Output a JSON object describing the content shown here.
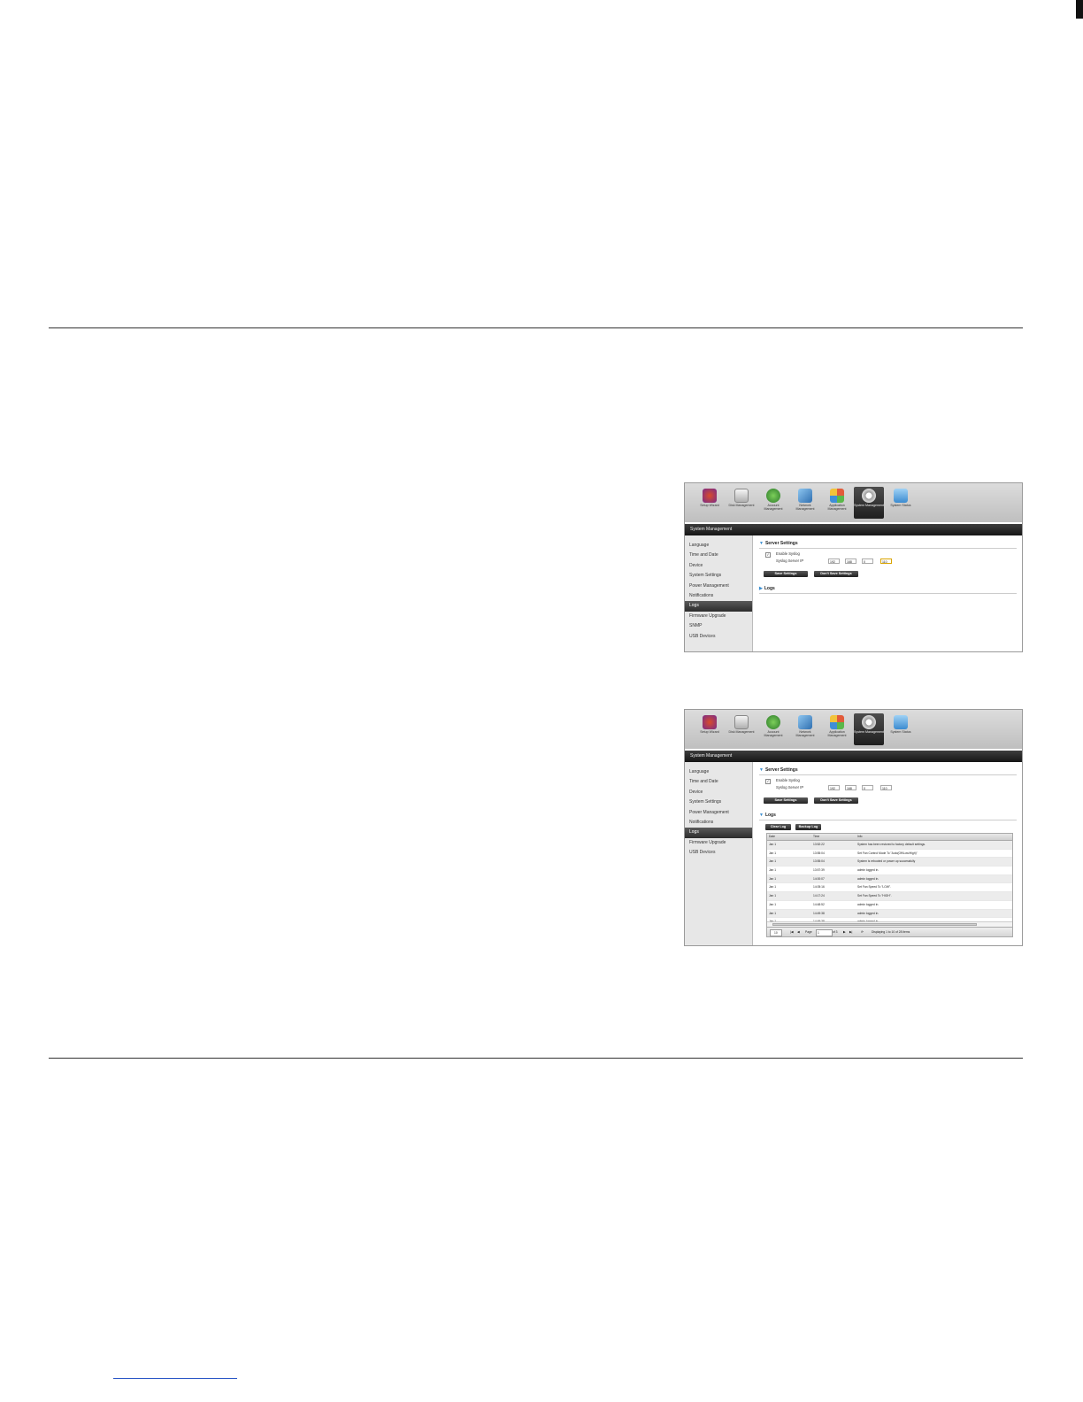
{
  "toolbar": {
    "items": [
      {
        "label": "Setup Wizard",
        "icon": "setup-wizard-icon"
      },
      {
        "label": "Disk Management",
        "icon": "disk-management-icon"
      },
      {
        "label": "Account Management",
        "icon": "account-management-icon"
      },
      {
        "label": "Network Management",
        "icon": "network-management-icon"
      },
      {
        "label": "Application Management",
        "icon": "application-management-icon"
      },
      {
        "label": "System Management",
        "icon": "system-management-icon",
        "active": true
      },
      {
        "label": "System Status",
        "icon": "system-status-icon"
      }
    ]
  },
  "panel_title": "System Management",
  "sidebar": {
    "items_top": [
      "Language",
      "Time and Date",
      "Device",
      "System Settings",
      "Power Management",
      "Notifications",
      "Logs",
      "Firmware Upgrade",
      "SNMP",
      "USB Devices"
    ],
    "items_bottom": [
      "Language",
      "Time and Date",
      "Device",
      "System Settings",
      "Power Management",
      "Notifications",
      "Logs",
      "Firmware Upgrade",
      "USB Devices"
    ],
    "active": "Logs"
  },
  "server_settings": {
    "title": "Server Settings",
    "enable_syslog_label": "Enable Syslog",
    "enable_syslog_checked": true,
    "server_ip_label": "Syslog Server IP",
    "ip_top": [
      "192",
      "168",
      "0",
      "110"
    ],
    "ip_bottom": [
      "192",
      "168",
      "0",
      "110"
    ],
    "save_label": "Save Settings",
    "dont_save_label": "Don't Save Settings"
  },
  "logs": {
    "title": "Logs",
    "clear_label": "Clear Log",
    "backup_label": "Backup Log",
    "columns": [
      "Date",
      "Time",
      "Info"
    ],
    "rows": [
      [
        "Jan 1",
        "13:52:22",
        "System has been restored to factory default settings."
      ],
      [
        "Jan 1",
        "13:55:04",
        "Set Fan Control Mode To \"Auto(Off/Low/High)\""
      ],
      [
        "Jan 1",
        "13:55:04",
        "System is rebooted or power up successfully"
      ],
      [
        "Jan 1",
        "13:57:39",
        "admin logged in."
      ],
      [
        "Jan 1",
        "14:00:07",
        "admin logged in."
      ],
      [
        "Jan 1",
        "14:05:16",
        "Set Fan Speed To \"LOW\"."
      ],
      [
        "Jan 1",
        "14:17:24",
        "Set Fan Speed To \"HIGH\"."
      ],
      [
        "Jan 1",
        "14:48:52",
        "admin logged in."
      ],
      [
        "Jan 1",
        "14:49:38",
        "admin logged in."
      ],
      [
        "Jan 1",
        "14:49:38",
        "admin logged in."
      ]
    ],
    "per_page": "10",
    "page_label": "Page",
    "page_value": "1",
    "of_label": "of 3",
    "display_text": "Displaying 1 to 10 of 28 items"
  }
}
